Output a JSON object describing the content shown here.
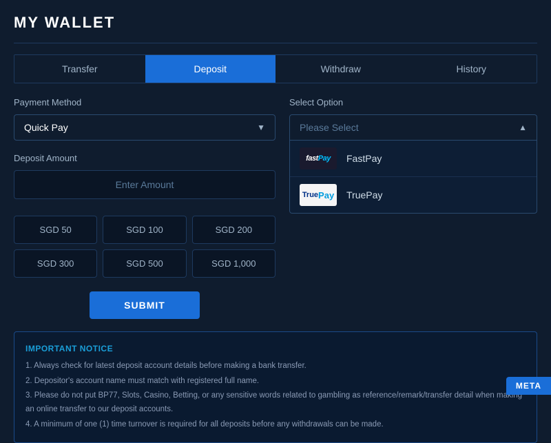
{
  "page": {
    "title": "MY WALLET"
  },
  "tabs": [
    {
      "id": "transfer",
      "label": "Transfer",
      "active": false
    },
    {
      "id": "deposit",
      "label": "Deposit",
      "active": true
    },
    {
      "id": "withdraw",
      "label": "Withdraw",
      "active": false
    },
    {
      "id": "history",
      "label": "History",
      "active": false
    }
  ],
  "left": {
    "payment_method_label": "Payment Method",
    "payment_method_value": "Quick Pay",
    "deposit_amount_label": "Deposit Amount",
    "amount_input_placeholder": "Enter Amount",
    "amount_buttons": [
      {
        "label": "SGD 50"
      },
      {
        "label": "SGD 100"
      },
      {
        "label": "SGD 200"
      },
      {
        "label": "SGD 300"
      },
      {
        "label": "SGD 500"
      },
      {
        "label": "SGD 1,000"
      }
    ],
    "submit_label": "SUBMIT"
  },
  "right": {
    "select_option_label": "Select Option",
    "select_placeholder": "Please Select",
    "options": [
      {
        "id": "fastpay",
        "name": "FastPay"
      },
      {
        "id": "truepay",
        "name": "TruePay"
      }
    ]
  },
  "notice": {
    "title": "IMPORTANT NOTICE",
    "items": [
      {
        "num": "1",
        "text": "Always check for latest deposit account details before making a bank transfer."
      },
      {
        "num": "2",
        "text": "Depositor's account name must match with registered full name."
      },
      {
        "num": "3",
        "text": "Please do not put BP77, Slots, Casino, Betting, or any sensitive words related to gambling as reference/remark/transfer detail when making an online transfer to our deposit accounts."
      },
      {
        "num": "4",
        "text": "A minimum of one (1) time turnover is required for all deposits before any withdrawals can be made."
      }
    ]
  },
  "meta_label": "META"
}
